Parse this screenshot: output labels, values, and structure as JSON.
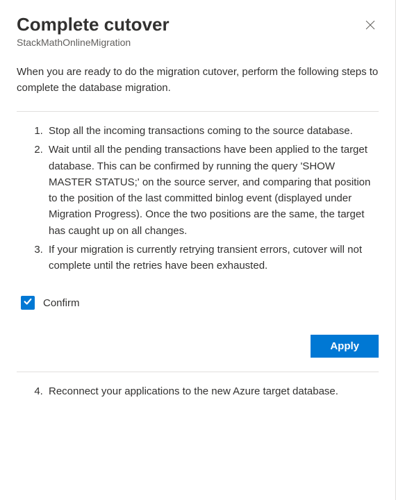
{
  "header": {
    "title": "Complete cutover",
    "subtitle": "StackMathOnlineMigration"
  },
  "intro": "When you are ready to do the migration cutover, perform the following steps to complete the database migration.",
  "steps": {
    "before": [
      "Stop all the incoming transactions coming to the source database.",
      "Wait until all the pending transactions have been applied to the target database. This can be confirmed by running the query 'SHOW MASTER STATUS;' on the source server, and comparing that position to the position of the last committed binlog event (displayed under Migration Progress). Once the two positions are the same, the target has caught up on all changes.",
      "If your migration is currently retrying transient errors, cutover will not complete until the retries have been exhausted."
    ],
    "after": [
      "Reconnect your applications to the new Azure target database."
    ]
  },
  "confirm": {
    "label": "Confirm",
    "checked": true
  },
  "actions": {
    "apply_label": "Apply"
  },
  "colors": {
    "primary": "#0078d4"
  }
}
